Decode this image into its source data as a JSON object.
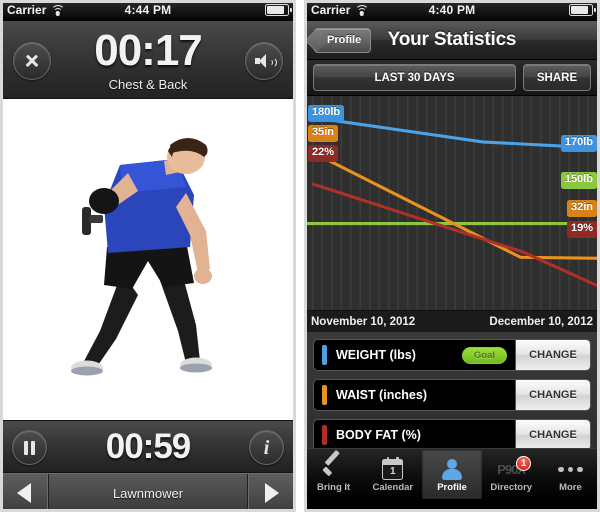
{
  "left_screen": {
    "status_bar": {
      "carrier": "Carrier",
      "time": "4:44 PM",
      "wifi_icon": "wifi-icon",
      "battery_icon": "battery-icon"
    },
    "header": {
      "close_icon": "close-x-icon",
      "timer": "00:17",
      "workout_name": "Chest & Back",
      "volume_icon": "speaker-volume-icon"
    },
    "video": {
      "alt": "man performing lawnmower dumbbell exercise"
    },
    "footer": {
      "pause_icon": "pause-icon",
      "interval_timer": "00:59",
      "info_icon": "info-icon",
      "prev_icon": "previous-arrow-icon",
      "exercise_name": "Lawnmower",
      "next_icon": "next-arrow-icon"
    }
  },
  "right_screen": {
    "status_bar": {
      "carrier": "Carrier",
      "time": "4:40 PM",
      "wifi_icon": "wifi-icon",
      "battery_icon": "battery-icon"
    },
    "nav": {
      "back_label": "Profile",
      "title": "Your Statistics"
    },
    "segments": {
      "range_label": "LAST 30 DAYS",
      "share_label": "SHARE"
    },
    "chart_footer": {
      "start_date": "November 10, 2012",
      "end_date": "December 10, 2012"
    },
    "metrics": [
      {
        "name": "WEIGHT (lbs)",
        "color": "#4aa3e8",
        "badge": "Goal",
        "action": "CHANGE"
      },
      {
        "name": "WAIST (inches)",
        "color": "#e8931f",
        "badge": null,
        "action": "CHANGE"
      },
      {
        "name": "BODY FAT (%)",
        "color": "#b03028",
        "badge": null,
        "action": "CHANGE"
      }
    ],
    "tabs": [
      {
        "label": "Bring It",
        "icon": "checkmark-icon",
        "active": false,
        "badge": null
      },
      {
        "label": "Calendar",
        "icon": "calendar-icon",
        "active": false,
        "badge": null,
        "day": "1"
      },
      {
        "label": "Profile",
        "icon": "person-icon",
        "active": true,
        "badge": null
      },
      {
        "label": "Directory",
        "icon": "p90x-logo-icon",
        "active": false,
        "badge": "1",
        "logo_text": "P90X"
      },
      {
        "label": "More",
        "icon": "ellipsis-icon",
        "active": false,
        "badge": null
      }
    ]
  },
  "chart_data": {
    "type": "line",
    "title": "Your Statistics",
    "xlabel": "",
    "ylabel": "",
    "x": [
      "November 10, 2012",
      "December 10, 2012"
    ],
    "grid": "vertical-stripes",
    "legend_position": "below-chart",
    "series": [
      {
        "name": "WEIGHT (lbs)",
        "color": "#4aa3e8",
        "start_label": "180lb",
        "end_label": "170lb",
        "values": [
          180,
          170
        ],
        "unit": "lb",
        "points": [
          [
            0.03,
            0.1
          ],
          [
            0.6,
            0.21
          ],
          [
            1.0,
            0.24
          ]
        ]
      },
      {
        "name": "GOAL WEIGHT",
        "color": "#8dc63f",
        "start_label": "",
        "end_label": "150lb",
        "values": [
          150,
          150
        ],
        "unit": "lb",
        "points": [
          [
            0.0,
            0.585
          ],
          [
            1.0,
            0.585
          ]
        ]
      },
      {
        "name": "WAIST (inches)",
        "color": "#e8931f",
        "start_label": "35in",
        "end_label": "32in",
        "values": [
          35,
          32
        ],
        "unit": "in",
        "points": [
          [
            0.03,
            0.255
          ],
          [
            0.73,
            0.74
          ],
          [
            1.0,
            0.745
          ]
        ]
      },
      {
        "name": "BODY FAT (%)",
        "color": "#b03028",
        "start_label": "22%",
        "end_label": "19%",
        "values": [
          22,
          19
        ],
        "unit": "%",
        "points": [
          [
            0.03,
            0.4
          ],
          [
            0.74,
            0.715
          ],
          [
            1.0,
            0.875
          ]
        ]
      }
    ]
  }
}
